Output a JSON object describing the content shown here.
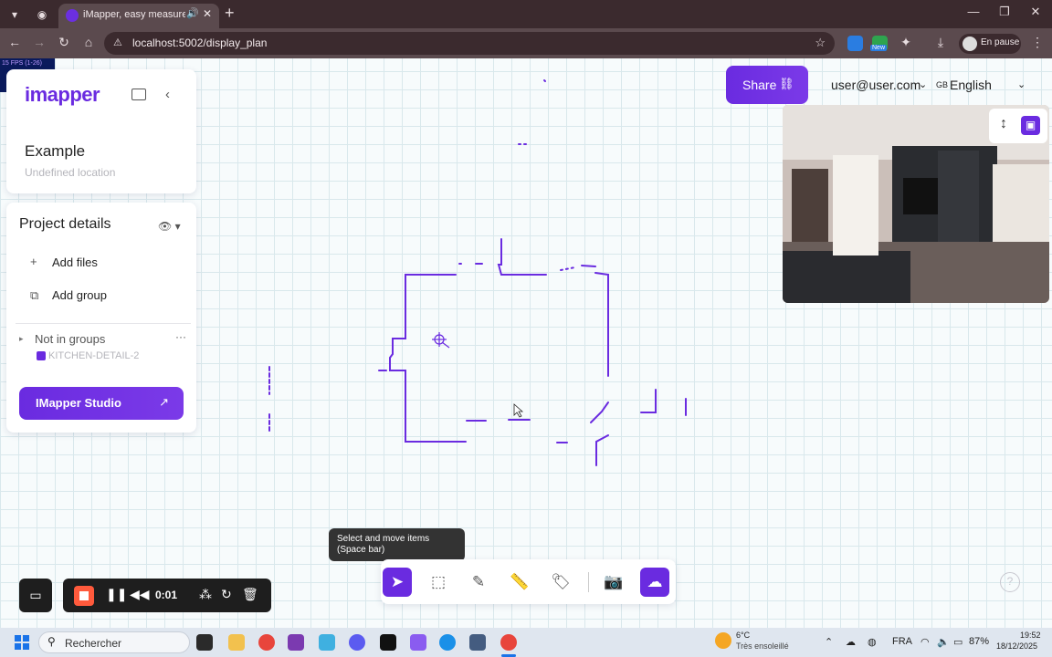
{
  "browser": {
    "tab_title": "iMapper, easy measuremen",
    "url": "localhost:5002/display_plan",
    "profile_label": "En pause",
    "ext_new_badge": "New"
  },
  "overlay": {
    "fps_text": "15 FPS (1-26)"
  },
  "sidebar": {
    "logo": "imapper",
    "project_title": "Example",
    "project_location": "Undefined location",
    "details_title": "Project details",
    "add_files_label": "Add files",
    "add_group_label": "Add group",
    "group_header": "Not in groups",
    "layer_item": "KITCHEN-DETAIL-2",
    "studio_button": "IMapper Studio"
  },
  "header": {
    "share_label": "Share",
    "user_email": "user@user.com",
    "lang_flag": "GB",
    "language": "English"
  },
  "toolbar": {
    "tooltip": "Select and move items (Space bar)",
    "tools": [
      "select-tool",
      "transform-tool",
      "annotate-tool",
      "measure-tool",
      "tag-tool",
      "photo-tool",
      "export-tool"
    ]
  },
  "recorder": {
    "time": "0:01"
  },
  "taskbar": {
    "search_placeholder": "Rechercher",
    "weather_temp": "6°C",
    "weather_desc": "Très ensoleillé",
    "language": "FRA",
    "battery": "87%",
    "time": "19:52",
    "date": "18/12/2025"
  },
  "colors": {
    "accent": "#6a2be0",
    "plan_line": "#6a2be0",
    "record": "#ff5a3c"
  }
}
